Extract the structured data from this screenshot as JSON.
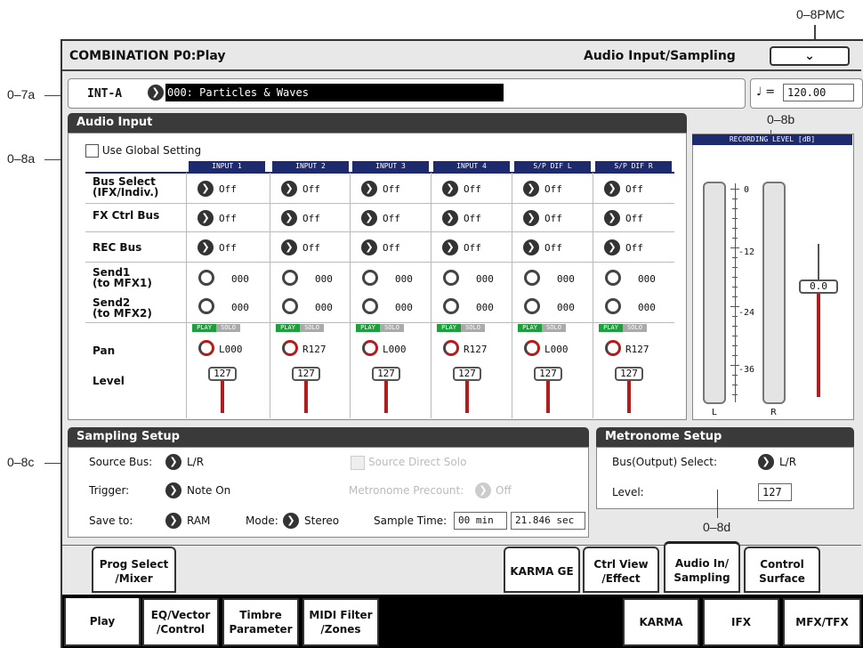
{
  "callouts": {
    "pmc": "0–8PMC",
    "c7a": "0–7a",
    "c8a": "0–8a",
    "c8b": "0–8b",
    "c8c": "0–8c",
    "c8d": "0–8d"
  },
  "header": {
    "mode_title": "COMBINATION P0:Play",
    "page_title": "Audio Input/Sampling",
    "menu_icon": "chevron-down"
  },
  "program": {
    "bank": "INT-A",
    "name": "000: Particles & Waves",
    "tempo_symbol": "♩ =",
    "tempo": "120.00"
  },
  "audio_input": {
    "title": "Audio Input",
    "use_global_label": "Use Global Setting",
    "columns": [
      "INPUT 1",
      "INPUT 2",
      "INPUT 3",
      "INPUT 4",
      "S/P DIF L",
      "S/P DIF R"
    ],
    "row_labels": {
      "bus_select_1": "Bus Select",
      "bus_select_2": "(IFX/Indiv.)",
      "fx_ctrl": "FX Ctrl Bus",
      "rec": "REC Bus",
      "send1_1": "Send1",
      "send1_2": "(to MFX1)",
      "send2_1": "Send2",
      "send2_2": "(to MFX2)",
      "pan": "Pan",
      "level": "Level"
    },
    "bus_select": [
      "Off",
      "Off",
      "Off",
      "Off",
      "Off",
      "Off"
    ],
    "fx_ctrl_bus": [
      "Off",
      "Off",
      "Off",
      "Off",
      "Off",
      "Off"
    ],
    "rec_bus": [
      "Off",
      "Off",
      "Off",
      "Off",
      "Off",
      "Off"
    ],
    "send1": [
      "000",
      "000",
      "000",
      "000",
      "000",
      "000"
    ],
    "send2": [
      "000",
      "000",
      "000",
      "000",
      "000",
      "000"
    ],
    "play_label": "PLAY",
    "solo_label": "SOLO",
    "pan": [
      "L000",
      "R127",
      "L000",
      "R127",
      "L000",
      "R127"
    ],
    "level": [
      "127",
      "127",
      "127",
      "127",
      "127",
      "127"
    ]
  },
  "recording_level": {
    "title": "RECORDING LEVEL [dB]",
    "scale": [
      "0",
      "-12",
      "-24",
      "-36"
    ],
    "value": "0.0",
    "left": "L",
    "right": "R"
  },
  "sampling_setup": {
    "title": "Sampling Setup",
    "source_bus_label": "Source Bus:",
    "source_bus": "L/R",
    "source_direct_solo": "Source Direct Solo",
    "trigger_label": "Trigger:",
    "trigger": "Note On",
    "metronome_precount_label": "Metronome Precount:",
    "metronome_precount": "Off",
    "save_to_label": "Save to:",
    "save_to": "RAM",
    "mode_label": "Mode:",
    "mode": "Stereo",
    "sample_time_label": "Sample Time:",
    "sample_min": "00 min",
    "sample_sec": "21.846 sec"
  },
  "metronome_setup": {
    "title": "Metronome Setup",
    "bus_label": "Bus(Output) Select:",
    "bus": "L/R",
    "level_label": "Level:",
    "level": "127"
  },
  "upper_tabs": {
    "prog_select_1": "Prog Select",
    "prog_select_2": "/Mixer",
    "karma_ge": "KARMA GE",
    "ctrl_view_1": "Ctrl View",
    "ctrl_view_2": "/Effect",
    "audio_in_1": "Audio In/",
    "audio_in_2": "Sampling",
    "control_1": "Control",
    "control_2": "Surface"
  },
  "lower_tabs": {
    "play": "Play",
    "eq_1": "EQ/Vector",
    "eq_2": "/Control",
    "timbre_1": "Timbre",
    "timbre_2": "Parameter",
    "midi_1": "MIDI Filter",
    "midi_2": "/Zones",
    "karma": "KARMA",
    "ifx": "IFX",
    "mfx": "MFX/TFX"
  }
}
